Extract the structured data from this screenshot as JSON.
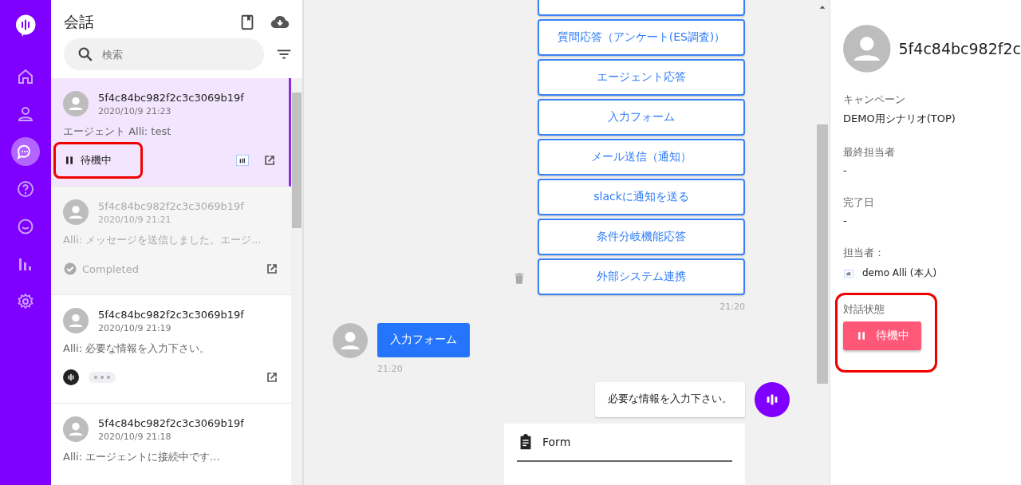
{
  "rail": {
    "items": [
      {
        "selected": false
      },
      {
        "selected": false
      },
      {
        "selected": true
      },
      {
        "selected": false
      },
      {
        "selected": false
      },
      {
        "selected": false
      },
      {
        "selected": false
      }
    ]
  },
  "list": {
    "title": "会話",
    "search": {
      "placeholder": "検索"
    },
    "conversations": [
      {
        "id": "5f4c84bc982f2c3c3069b19f",
        "date": "2020/10/9 21:23",
        "preview": "エージェント Alli: test",
        "selected": true,
        "muted": false,
        "status": {
          "kind": "paused",
          "label": "待機中",
          "highlighted": true
        },
        "agent_badge": true
      },
      {
        "id": "5f4c84bc982f2c3c3069b19f",
        "date": "2020/10/9 21:21",
        "preview": "Alli: メッセージを送信しました。エージ...",
        "selected": false,
        "muted": true,
        "status": {
          "kind": "completed",
          "label": "Completed",
          "highlighted": false
        }
      },
      {
        "id": "5f4c84bc982f2c3c3069b19f",
        "date": "2020/10/9 21:19",
        "preview": "Alli: 必要な情報を入力下さい。",
        "selected": false,
        "muted": false,
        "status": {
          "kind": "typing",
          "highlighted": false
        }
      },
      {
        "id": "5f4c84bc982f2c3c3069b19f",
        "date": "2020/10/9 21:18",
        "preview": "Alli: エージェントに接続中です...",
        "selected": false,
        "muted": false
      }
    ]
  },
  "chat": {
    "options": [
      "質問応答（アンケート(ES調査)）",
      "エージェント応答",
      "入力フォーム",
      "メール送信（通知）",
      "slackに通知を送る",
      "条件分岐機能応答",
      "外部システム連携"
    ],
    "options_time": "21:20",
    "messages": [
      {
        "kind": "user",
        "text": "入力フォーム",
        "time": "21:20"
      },
      {
        "kind": "bot",
        "text": "必要な情報を入力下さい。"
      }
    ],
    "form": {
      "title": "Form"
    }
  },
  "detail": {
    "name": "5f4c84bc982f2c",
    "fields": [
      {
        "label": "キャンペーン",
        "value": "DEMO用シナリオ(TOP)"
      },
      {
        "label": "最終担当者",
        "value": "-"
      },
      {
        "label": "完了日",
        "value": "-"
      }
    ],
    "assignee_label": "担当者：",
    "assignee": "demo Alli (本人)",
    "state_label": "対話状態",
    "state": {
      "kind": "paused",
      "label": "待機中",
      "highlighted": true
    }
  }
}
